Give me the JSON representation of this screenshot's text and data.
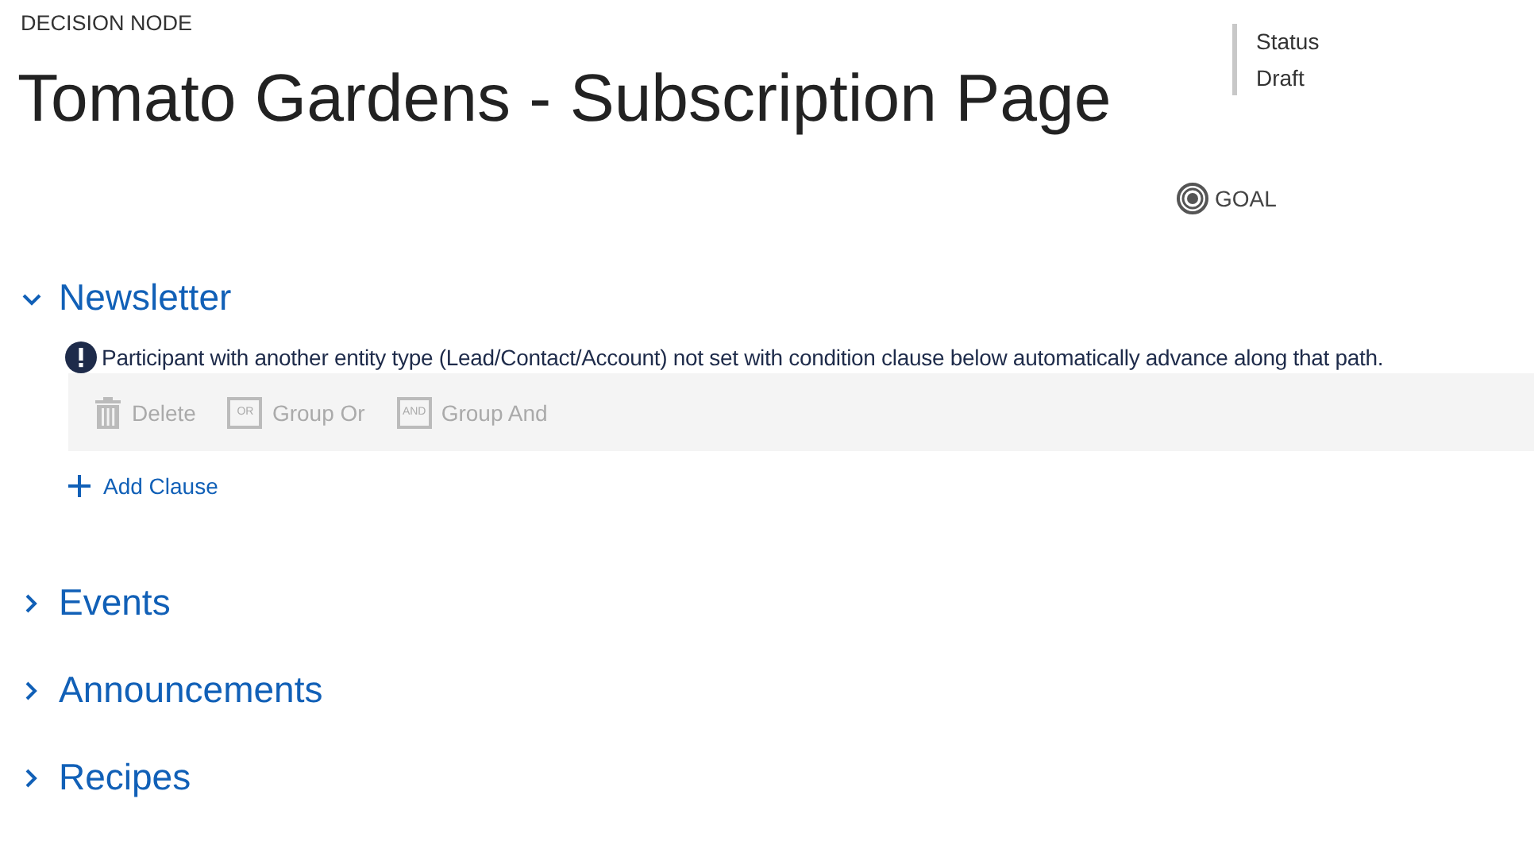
{
  "header": {
    "label": "DECISION NODE",
    "title": "Tomato Gardens - Subscription Page"
  },
  "status": {
    "label": "Status",
    "value": "Draft"
  },
  "goal": {
    "label": "GOAL"
  },
  "sections": [
    {
      "title": "Newsletter",
      "expanded": true,
      "notice": "Participant with another entity type (Lead/Contact/Account) not set with condition clause below automatically advance along that path.",
      "toolbar": [
        {
          "kind": "delete",
          "label": "Delete",
          "disabled": true
        },
        {
          "kind": "or",
          "label": "Group Or",
          "icon_text": "OR",
          "disabled": true
        },
        {
          "kind": "and",
          "label": "Group And",
          "icon_text": "AND",
          "disabled": true
        }
      ],
      "add_label": "Add Clause"
    },
    {
      "title": "Events",
      "expanded": false
    },
    {
      "title": "Announcements",
      "expanded": false
    },
    {
      "title": "Recipes",
      "expanded": false
    }
  ]
}
